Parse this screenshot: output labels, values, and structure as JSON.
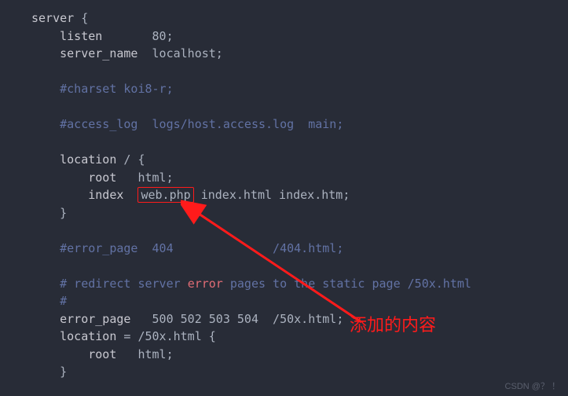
{
  "code": {
    "l1a": "server",
    "l1b": " {",
    "l2a": "    listen",
    "l2b": "       ",
    "l2c": "80",
    "l2d": ";",
    "l3a": "    server_name",
    "l3b": "  localhost;",
    "l4": "",
    "l5": "    #charset koi8-r;",
    "l6": "",
    "l7": "    #access_log  logs/host.access.log  main;",
    "l8": "",
    "l9a": "    location",
    "l9b": " / {",
    "l10a": "        root",
    "l10b": "   html;",
    "l11a": "        index",
    "l11b": "  ",
    "l11box": "web.php",
    "l11c": " index.html index.htm;",
    "l12": "    }",
    "l13": "",
    "l14": "    #error_page  404              /404.html;",
    "l15": "",
    "l16a": "    # redirect server ",
    "l16err": "error",
    "l16b": " pages to the static page /50x.html",
    "l17": "    #",
    "l18a": "    error_page",
    "l18b": "   ",
    "l18c": "500",
    "l18d": " ",
    "l18e": "502",
    "l18f": " ",
    "l18g": "503",
    "l18h": " ",
    "l18i": "504",
    "l18j": "  /50x.html;",
    "l19a": "    location",
    "l19b": " = /50x.html {",
    "l20a": "        root",
    "l20b": "   html;",
    "l21": "    }"
  },
  "annotation": "添加的内容",
  "watermark": "CSDN @？ ！"
}
